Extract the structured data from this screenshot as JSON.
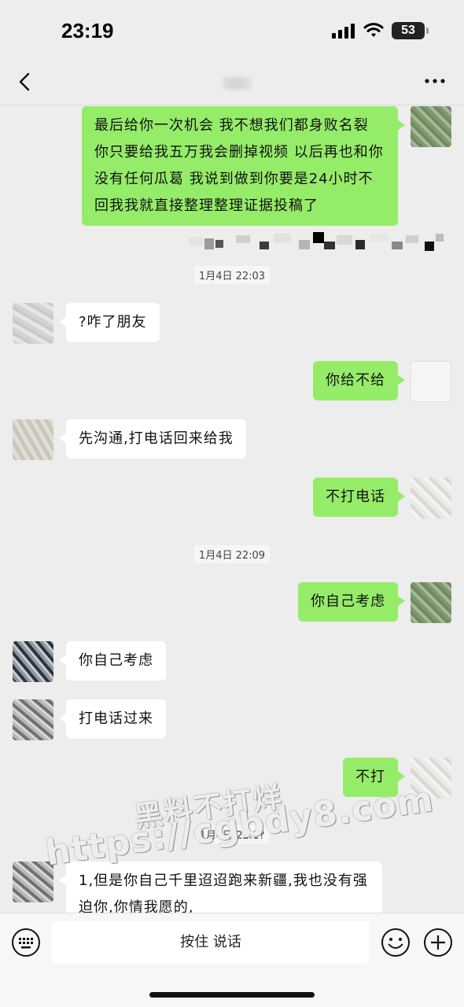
{
  "status_bar": {
    "time": "23:19",
    "battery": "53"
  },
  "messages": [
    {
      "side": "me",
      "text": "最后给你一次机会 我不想我们都身败名裂 你只要给我五万我会删掉视频 以后再也和你没有任何瓜葛 我说到做到你要是24小时不回我我就直接整理整理证据投稿了"
    },
    {
      "timestamp": "1月4日 22:03"
    },
    {
      "side": "them",
      "text": "?咋了朋友"
    },
    {
      "side": "me",
      "text": "你给不给"
    },
    {
      "side": "them",
      "text": "先沟通,打电话回来给我"
    },
    {
      "side": "me",
      "text": "不打电话"
    },
    {
      "timestamp": "1月4日 22:09"
    },
    {
      "side": "me",
      "text": "你自己考虑"
    },
    {
      "side": "them",
      "text": "你自己考虑"
    },
    {
      "side": "them",
      "text": "打电话过来"
    },
    {
      "side": "me",
      "text": "不打"
    },
    {
      "timestamp": "1月4日 22:1?"
    },
    {
      "side": "them",
      "text": "1,但是你自己千里迢迢跑来新疆,我也没有强迫你,你情我愿的,"
    }
  ],
  "watermark": {
    "line1": "黑料不打烊",
    "line2": "https://cgbdy8.com"
  },
  "input_bar": {
    "voice_label": "按住 说话"
  },
  "colors": {
    "my_bubble": "#95ec69",
    "their_bubble": "#ffffff",
    "background": "#ededed"
  }
}
